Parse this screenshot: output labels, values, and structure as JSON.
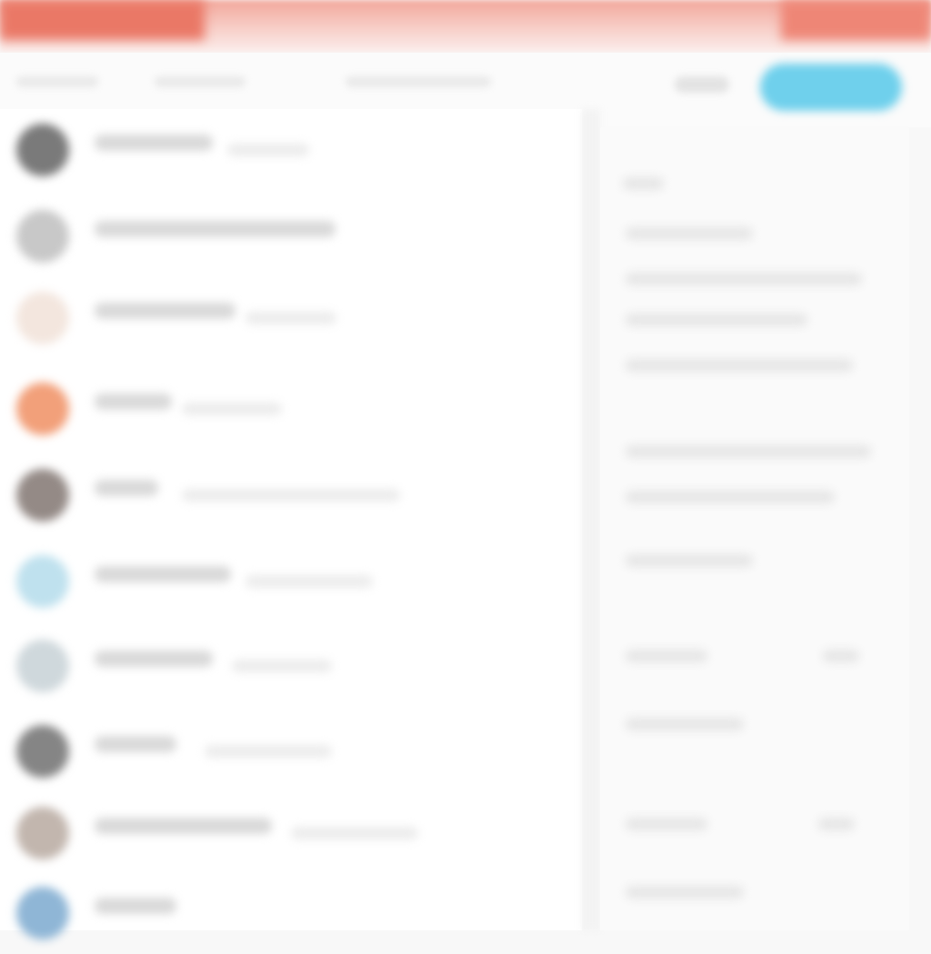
{
  "colors": {
    "accent_red": "#ea7866",
    "follow_button": "#6fd0ec",
    "avatar_colors": [
      "#7a7a7a",
      "#c8c8c8",
      "#f3e6de",
      "#f2a07a",
      "#948a86",
      "#bfe1ee",
      "#cfd8dc",
      "#858585",
      "#c2b6ae",
      "#8fb6d6"
    ]
  },
  "icons": {
    "follow_button": "",
    "menu": ""
  }
}
